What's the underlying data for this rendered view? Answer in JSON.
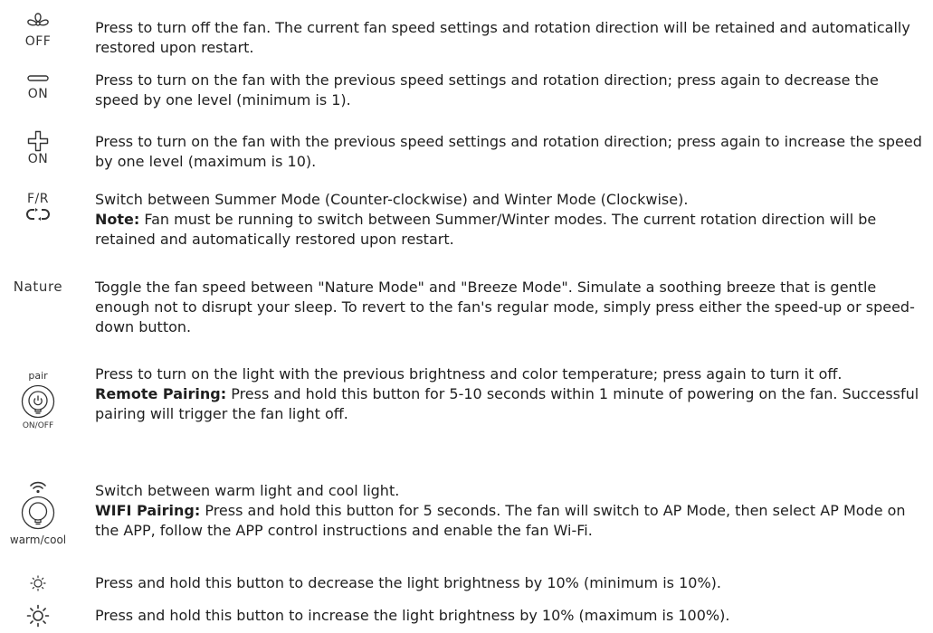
{
  "items": [
    {
      "icon": "fan-icon",
      "icon_label": "OFF",
      "lines": [
        "Press to turn off the fan. The current fan speed settings and rotation direction will be retained and automatically restored upon restart."
      ]
    },
    {
      "icon": "minus-icon",
      "icon_label": "ON",
      "lines": [
        "Press to turn on the fan with the previous speed settings and rotation direction; press again to decrease the speed by one level (minimum is 1)."
      ]
    },
    {
      "icon": "plus-icon",
      "icon_label": "ON",
      "lines": [
        "Press to turn on the fan with the previous speed settings and rotation direction; press again to increase the speed by one level (maximum is 10)."
      ]
    },
    {
      "icon": "reverse-icon",
      "icon_label": "F/R",
      "lines": [
        "Switch between Summer Mode (Counter-clockwise) and Winter Mode (Clockwise)."
      ],
      "note_bold": "Note:",
      "note_text": " Fan must be running to switch between Summer/Winter modes. The current rotation direction will be retained and automatically restored upon restart."
    },
    {
      "icon": "nature-icon",
      "icon_label": "Nature",
      "lines": [
        "Toggle the fan speed between \"Nature Mode\" and \"Breeze Mode\". Simulate a soothing breeze that is gentle enough not to disrupt your sleep. To revert to the fan's regular mode, simply press either the speed-up or speed-down button."
      ]
    },
    {
      "icon": "power-bulb-icon",
      "icon_label_top": "pair",
      "icon_label": "ON/OFF",
      "lines": [
        "Press to turn on the light with the previous brightness and color temperature; press again to turn it off."
      ],
      "note_bold": "Remote Pairing:",
      "note_text": " Press and hold this button for 5-10 seconds within 1 minute of powering on the fan. Successful pairing will trigger the fan light off."
    },
    {
      "icon": "wifi-bulb-icon",
      "icon_label": "warm/cool",
      "lines": [
        "Switch between warm light and cool light."
      ],
      "note_bold": "WIFI Pairing:",
      "note_text": " Press and hold this button for 5 seconds. The fan will switch to AP Mode, then select AP Mode on the APP, follow the APP control instructions and enable the fan Wi-Fi."
    },
    {
      "icon": "brightness-down-icon",
      "lines": [
        "Press and hold this button to decrease the light brightness by 10% (minimum is 10%)."
      ]
    },
    {
      "icon": "brightness-up-icon",
      "lines": [
        "Press and hold this button to increase the light brightness by 10% (maximum is 100%)."
      ]
    }
  ]
}
